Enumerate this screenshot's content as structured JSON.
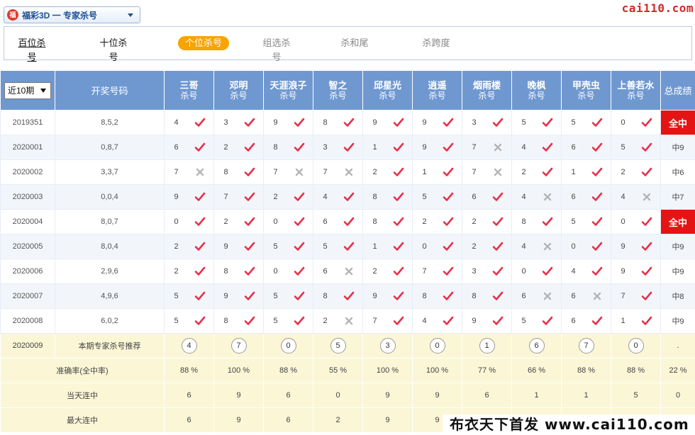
{
  "header": {
    "logo_text": "福",
    "lottery_title": "福彩3D 一 专家杀号",
    "brand": "cai110.com"
  },
  "tabs": [
    {
      "label": "百位杀号",
      "state": "current"
    },
    {
      "label": "十位杀号",
      "state": "plain"
    },
    {
      "label": "个位杀号",
      "state": "active"
    },
    {
      "label": "组选杀号",
      "state": "inactive"
    },
    {
      "label": "杀和尾",
      "state": "inactive"
    },
    {
      "label": "杀跨度",
      "state": "inactive"
    }
  ],
  "table": {
    "period_select_value": "近10期",
    "draw_header": "开奖号码",
    "total_header": "总成绩",
    "expert_suffix": "杀号",
    "experts": [
      "三哥",
      "邓明",
      "天涯浪子",
      "智之",
      "邱星光",
      "逍遥",
      "烟雨楼",
      "晚枫",
      "甲壳虫",
      "上善若水"
    ],
    "rows": [
      {
        "period": "2019351",
        "draw": "8,5,2",
        "kills": [
          "4",
          "3",
          "9",
          "8",
          "9",
          "9",
          "3",
          "5",
          "5",
          "0"
        ],
        "marks": [
          "y",
          "y",
          "y",
          "y",
          "y",
          "y",
          "y",
          "y",
          "y",
          "y"
        ],
        "total": "全中",
        "full": true
      },
      {
        "period": "2020001",
        "draw": "0,8,7",
        "kills": [
          "6",
          "2",
          "8",
          "3",
          "1",
          "9",
          "7",
          "4",
          "6",
          "5"
        ],
        "marks": [
          "y",
          "y",
          "y",
          "y",
          "y",
          "y",
          "n",
          "y",
          "y",
          "y"
        ],
        "total": "中9",
        "full": false
      },
      {
        "period": "2020002",
        "draw": "3,3,7",
        "kills": [
          "7",
          "8",
          "7",
          "7",
          "2",
          "1",
          "7",
          "2",
          "1",
          "2"
        ],
        "marks": [
          "n",
          "y",
          "n",
          "n",
          "y",
          "y",
          "n",
          "y",
          "y",
          "y"
        ],
        "total": "中6",
        "full": false
      },
      {
        "period": "2020003",
        "draw": "0,0,4",
        "kills": [
          "9",
          "7",
          "2",
          "4",
          "8",
          "5",
          "6",
          "4",
          "6",
          "4"
        ],
        "marks": [
          "y",
          "y",
          "y",
          "y",
          "y",
          "y",
          "y",
          "n",
          "y",
          "n"
        ],
        "total": "中7",
        "full": false
      },
      {
        "period": "2020004",
        "draw": "8,0,7",
        "kills": [
          "0",
          "2",
          "0",
          "6",
          "8",
          "2",
          "2",
          "8",
          "5",
          "0"
        ],
        "marks": [
          "y",
          "y",
          "y",
          "y",
          "y",
          "y",
          "y",
          "y",
          "y",
          "y"
        ],
        "total": "全中",
        "full": true
      },
      {
        "period": "2020005",
        "draw": "8,0,4",
        "kills": [
          "2",
          "9",
          "5",
          "5",
          "1",
          "0",
          "2",
          "4",
          "0",
          "9"
        ],
        "marks": [
          "y",
          "y",
          "y",
          "y",
          "y",
          "y",
          "y",
          "n",
          "y",
          "y"
        ],
        "total": "中9",
        "full": false
      },
      {
        "period": "2020006",
        "draw": "2,9,6",
        "kills": [
          "2",
          "8",
          "0",
          "6",
          "2",
          "7",
          "3",
          "0",
          "4",
          "9"
        ],
        "marks": [
          "y",
          "y",
          "y",
          "n",
          "y",
          "y",
          "y",
          "y",
          "y",
          "y"
        ],
        "total": "中9",
        "full": false
      },
      {
        "period": "2020007",
        "draw": "4,9,6",
        "kills": [
          "5",
          "9",
          "5",
          "8",
          "9",
          "8",
          "8",
          "6",
          "6",
          "7"
        ],
        "marks": [
          "y",
          "y",
          "y",
          "y",
          "y",
          "y",
          "y",
          "n",
          "n",
          "y"
        ],
        "total": "中8",
        "full": false
      },
      {
        "period": "2020008",
        "draw": "6,0,2",
        "kills": [
          "5",
          "8",
          "5",
          "2",
          "7",
          "4",
          "9",
          "5",
          "6",
          "1"
        ],
        "marks": [
          "y",
          "y",
          "y",
          "n",
          "y",
          "y",
          "y",
          "y",
          "y",
          "y"
        ],
        "total": "中9",
        "full": false
      }
    ],
    "recommend": {
      "period": "2020009",
      "label": "本期专家杀号推荐",
      "values": [
        "4",
        "7",
        "0",
        "5",
        "3",
        "0",
        "1",
        "6",
        "7",
        "0"
      ],
      "total": "."
    },
    "stats": [
      {
        "label": "准确率(全中率)",
        "values": [
          "88 %",
          "100 %",
          "88 %",
          "55 %",
          "100 %",
          "100 %",
          "77 %",
          "66 %",
          "88 %",
          "88 %"
        ],
        "total": "22 %"
      },
      {
        "label": "当天连中",
        "values": [
          "6",
          "9",
          "6",
          "0",
          "9",
          "9",
          "6",
          "1",
          "1",
          "5"
        ],
        "total": "0"
      },
      {
        "label": "最大连中",
        "values": [
          "6",
          "9",
          "6",
          "2",
          "9",
          "9",
          "",
          "",
          "",
          ""
        ],
        "total": ""
      }
    ]
  },
  "footer": {
    "banner": "布衣天下首发 www.cai110.com"
  },
  "colors": {
    "header_blue": "#6f98d1",
    "check_red": "#e8304a",
    "cross_gray": "#b5b5b5",
    "full_red": "#e51414",
    "stat_bg": "#fbf6d6",
    "tab_active": "#f7a400"
  }
}
